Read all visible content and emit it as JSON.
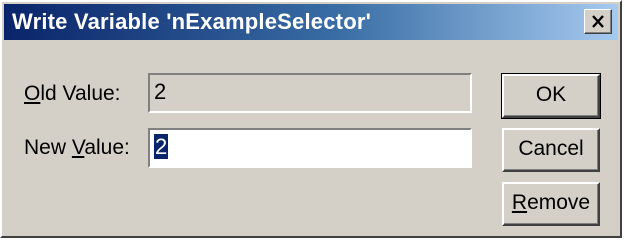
{
  "window": {
    "title": "Write Variable 'nExampleSelector'",
    "close_label": "×"
  },
  "form": {
    "old_value_label_prefix": "",
    "old_value_label_accel": "O",
    "old_value_label_rest": "ld Value:",
    "old_value": "2",
    "new_value_label_prefix": "New ",
    "new_value_label_accel": "V",
    "new_value_label_rest": "alue:",
    "new_value": "2"
  },
  "buttons": {
    "ok_label": "OK",
    "cancel_label": "Cancel",
    "remove_accel": "R",
    "remove_rest": "emove"
  },
  "colors": {
    "face": "#d4d0c8",
    "title_start": "#0a246a",
    "title_end": "#a6caf0",
    "selection": "#0a246a"
  },
  "icons": {
    "close": "close-icon"
  }
}
